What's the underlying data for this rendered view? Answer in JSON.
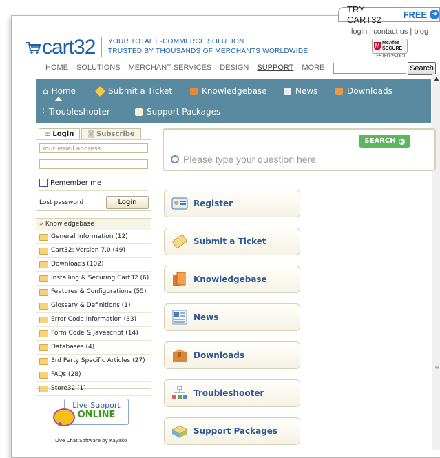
{
  "promo": {
    "try_label": "TRY CART32",
    "free_label": "FREE",
    "arrow": "➜"
  },
  "toplinks": "login  | contact us  | blog",
  "mcafee": {
    "brand": "McAfee",
    "secure": "SECURE",
    "tested": "TESTED 25-OCT"
  },
  "logo": {
    "word": "cart32"
  },
  "tagline": {
    "line1": "YOUR TOTAL E-COMMERCE SOLUTION",
    "line2": "TRUSTED BY THOUSANDS OF MERCHANTS WORLDWIDE"
  },
  "main_nav": [
    "HOME",
    "SOLUTIONS",
    "MERCHANT SERVICES",
    "DESIGN",
    "SUPPORT",
    "MORE"
  ],
  "search": {
    "value": "",
    "button": "Search"
  },
  "support_nav": {
    "home": "Home",
    "submit": "Submit a Ticket",
    "kb": "Knowledgebase",
    "news": "News",
    "downloads": "Downloads",
    "troubleshooter": "Troubleshooter",
    "packages": "Support Packages"
  },
  "login_tabs": {
    "login": "Login",
    "subscribe": "Subscribe"
  },
  "login": {
    "email_placeholder": "Your email address",
    "password_value": "",
    "remember": "Remember me",
    "lost": "Lost password",
    "button": "Login"
  },
  "kb": {
    "header": "Knowledgebase",
    "items": [
      "General Information (12)",
      "Cart32: Version 7.0 (49)",
      "Downloads (102)",
      "Installing & Securing Cart32 (6)",
      "Features & Configurations (55)",
      "Glossary & Definitions (1)",
      "Error Code Information (33)",
      "Form Code & Javascript (14)",
      "Databases (4)",
      "3rd Party Specific Articles (27)",
      "FAQs (28)",
      "Store32 (1)"
    ]
  },
  "live_support": {
    "line1": "Live Support",
    "line2": "ONLINE",
    "caption": "Live Chat Software by Kayako"
  },
  "question": {
    "placeholder": "Please type your question here",
    "search_button": "SEARCH"
  },
  "links": [
    "Register",
    "Submit a Ticket",
    "Knowledgebase",
    "News",
    "Downloads",
    "Troubleshooter",
    "Support Packages"
  ],
  "colors": {
    "nav_bar": "#5a8aa0",
    "link_text": "#2a5a9a",
    "search_btn": "#5cb65c",
    "brand_blue": "#1b5fa8"
  }
}
